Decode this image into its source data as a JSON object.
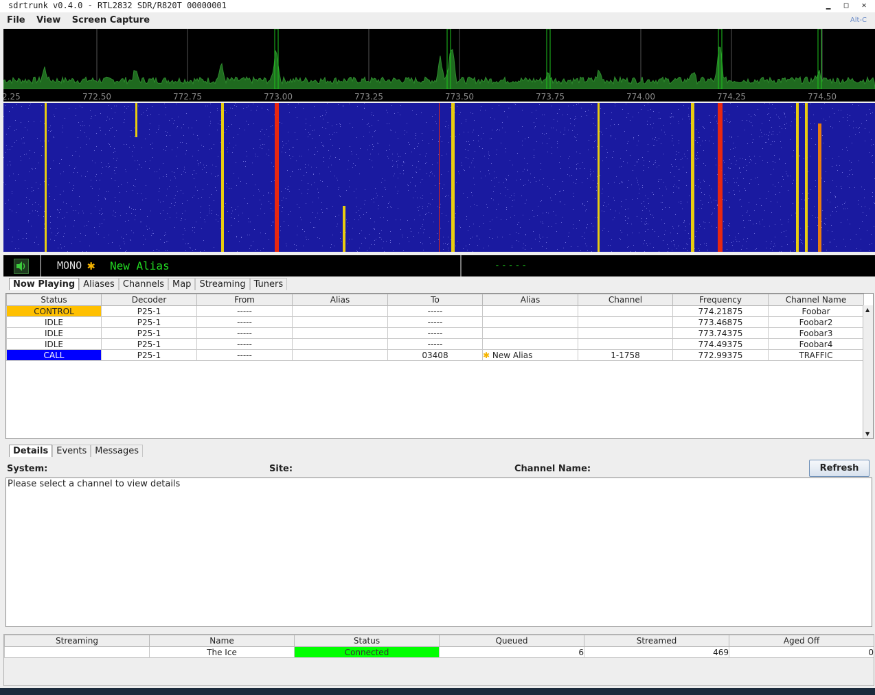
{
  "window": {
    "title": "sdrtrunk v0.4.0 - RTL2832 SDR/R820T 00000001",
    "controls": [
      "▁",
      "□",
      "✕"
    ]
  },
  "menu": {
    "items": [
      "File",
      "View",
      "Screen Capture"
    ],
    "shortcut": "Alt-C"
  },
  "spectrum": {
    "freq_labels": [
      "2.25",
      "772.50",
      "772.75",
      "773.00",
      "773.25",
      "773.50",
      "773.75",
      "774.00",
      "774.25",
      "774.50"
    ],
    "colors": {
      "trace": "#2e8b2e",
      "fill": "#1f6a1f",
      "background": "#000000",
      "channel_marker": "#1ec81e"
    }
  },
  "waterfall": {
    "colors": {
      "background": "#1a1aa0",
      "signal_strong": "#ff2a00",
      "signal_mid": "#ffe000"
    }
  },
  "audio_panel": {
    "speaker_icon": "speaker-icon",
    "mode": "MONO",
    "alias_icon": "star-icon",
    "alias": "New Alias",
    "right_text": "-----"
  },
  "main_tabs": {
    "items": [
      "Now Playing",
      "Aliases",
      "Channels",
      "Map",
      "Streaming",
      "Tuners"
    ],
    "selected": "Now Playing"
  },
  "channels_table": {
    "columns": [
      "Status",
      "Decoder",
      "From",
      "Alias",
      "To",
      "Alias",
      "Channel",
      "Frequency",
      "Channel Name"
    ],
    "rows": [
      {
        "status": "CONTROL",
        "decoder": "P25-1",
        "from": "-----",
        "from_alias": "",
        "to": "-----",
        "to_alias": "",
        "channel": "",
        "frequency": "774.21875",
        "channel_name": "Foobar"
      },
      {
        "status": "IDLE",
        "decoder": "P25-1",
        "from": "-----",
        "from_alias": "",
        "to": "-----",
        "to_alias": "",
        "channel": "",
        "frequency": "773.46875",
        "channel_name": "Foobar2"
      },
      {
        "status": "IDLE",
        "decoder": "P25-1",
        "from": "-----",
        "from_alias": "",
        "to": "-----",
        "to_alias": "",
        "channel": "",
        "frequency": "773.74375",
        "channel_name": "Foobar3"
      },
      {
        "status": "IDLE",
        "decoder": "P25-1",
        "from": "-----",
        "from_alias": "",
        "to": "-----",
        "to_alias": "",
        "channel": "",
        "frequency": "774.49375",
        "channel_name": "Foobar4"
      },
      {
        "status": "CALL",
        "decoder": "P25-1",
        "from": "-----",
        "from_alias": "",
        "to": "03408",
        "to_alias": "New Alias",
        "channel": "1-1758",
        "frequency": "772.99375",
        "channel_name": "TRAFFIC"
      }
    ],
    "status_colors": {
      "CONTROL": "#ffc000",
      "CALL": "#0000ff"
    }
  },
  "detail_tabs": {
    "items": [
      "Details",
      "Events",
      "Messages"
    ],
    "selected": "Details"
  },
  "details": {
    "system_label": "System:",
    "site_label": "Site:",
    "channel_name_label": "Channel Name:",
    "refresh_label": "Refresh",
    "message": "Please select a channel to view details"
  },
  "streaming_table": {
    "columns": [
      "Streaming",
      "Name",
      "Status",
      "Queued",
      "Streamed",
      "Aged Off"
    ],
    "rows": [
      {
        "streaming": "",
        "name": "The Ice",
        "status": "Connected",
        "queued": "6",
        "streamed": "469",
        "aged_off": "0"
      }
    ],
    "connected_color": "#00ff00"
  }
}
